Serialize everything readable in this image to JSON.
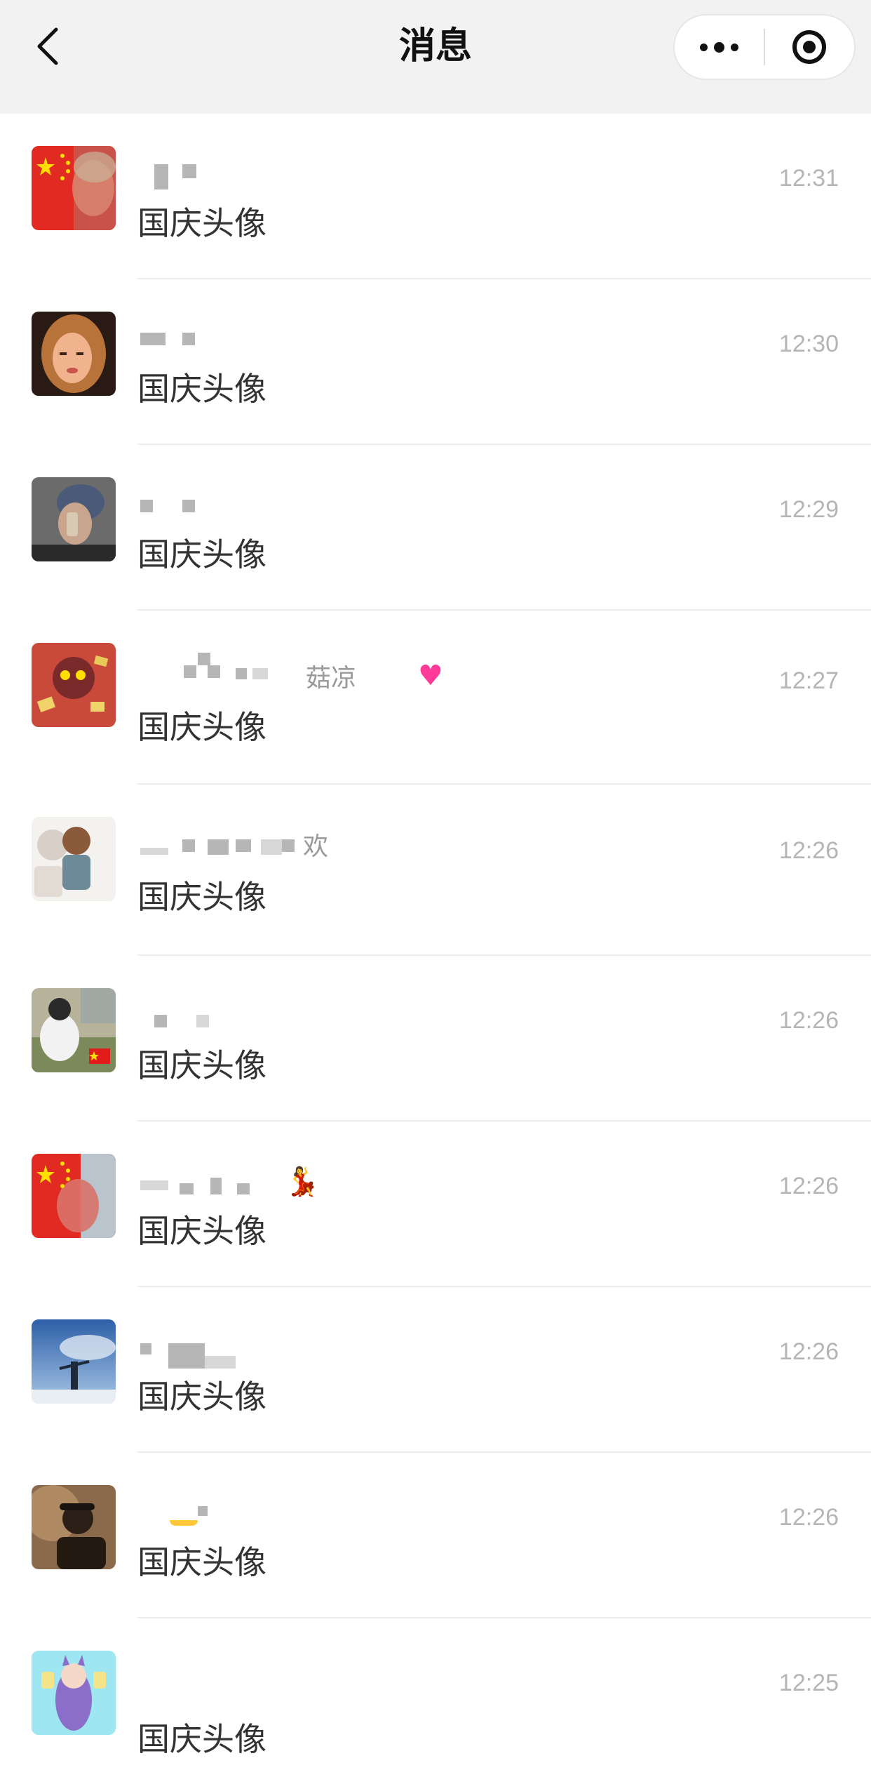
{
  "header": {
    "title": "消息",
    "back_icon": "chevron-left-icon",
    "more_icon": "more-dots-icon",
    "close_icon": "target-circle-icon"
  },
  "messages": [
    {
      "time": "12:31",
      "preview": "国庆头像",
      "name": ""
    },
    {
      "time": "12:30",
      "preview": "国庆头像",
      "name": ""
    },
    {
      "time": "12:29",
      "preview": "国庆头像",
      "name": ""
    },
    {
      "time": "12:27",
      "preview": "国庆头像",
      "name": "菇凉"
    },
    {
      "time": "12:26",
      "preview": "国庆头像",
      "name": "欢"
    },
    {
      "time": "12:26",
      "preview": "国庆头像",
      "name": ""
    },
    {
      "time": "12:26",
      "preview": "国庆头像",
      "name": ""
    },
    {
      "time": "12:26",
      "preview": "国庆头像",
      "name": ""
    },
    {
      "time": "12:26",
      "preview": "国庆头像",
      "name": ""
    },
    {
      "time": "12:25",
      "preview": "国庆头像",
      "name": ""
    }
  ],
  "colors": {
    "header_bg": "#f2f2f2",
    "time_text": "#b5b5b5",
    "preview_text": "#333333",
    "separator": "#ededed",
    "flag_red": "#e21b1b",
    "flag_yellow": "#ffde00"
  }
}
